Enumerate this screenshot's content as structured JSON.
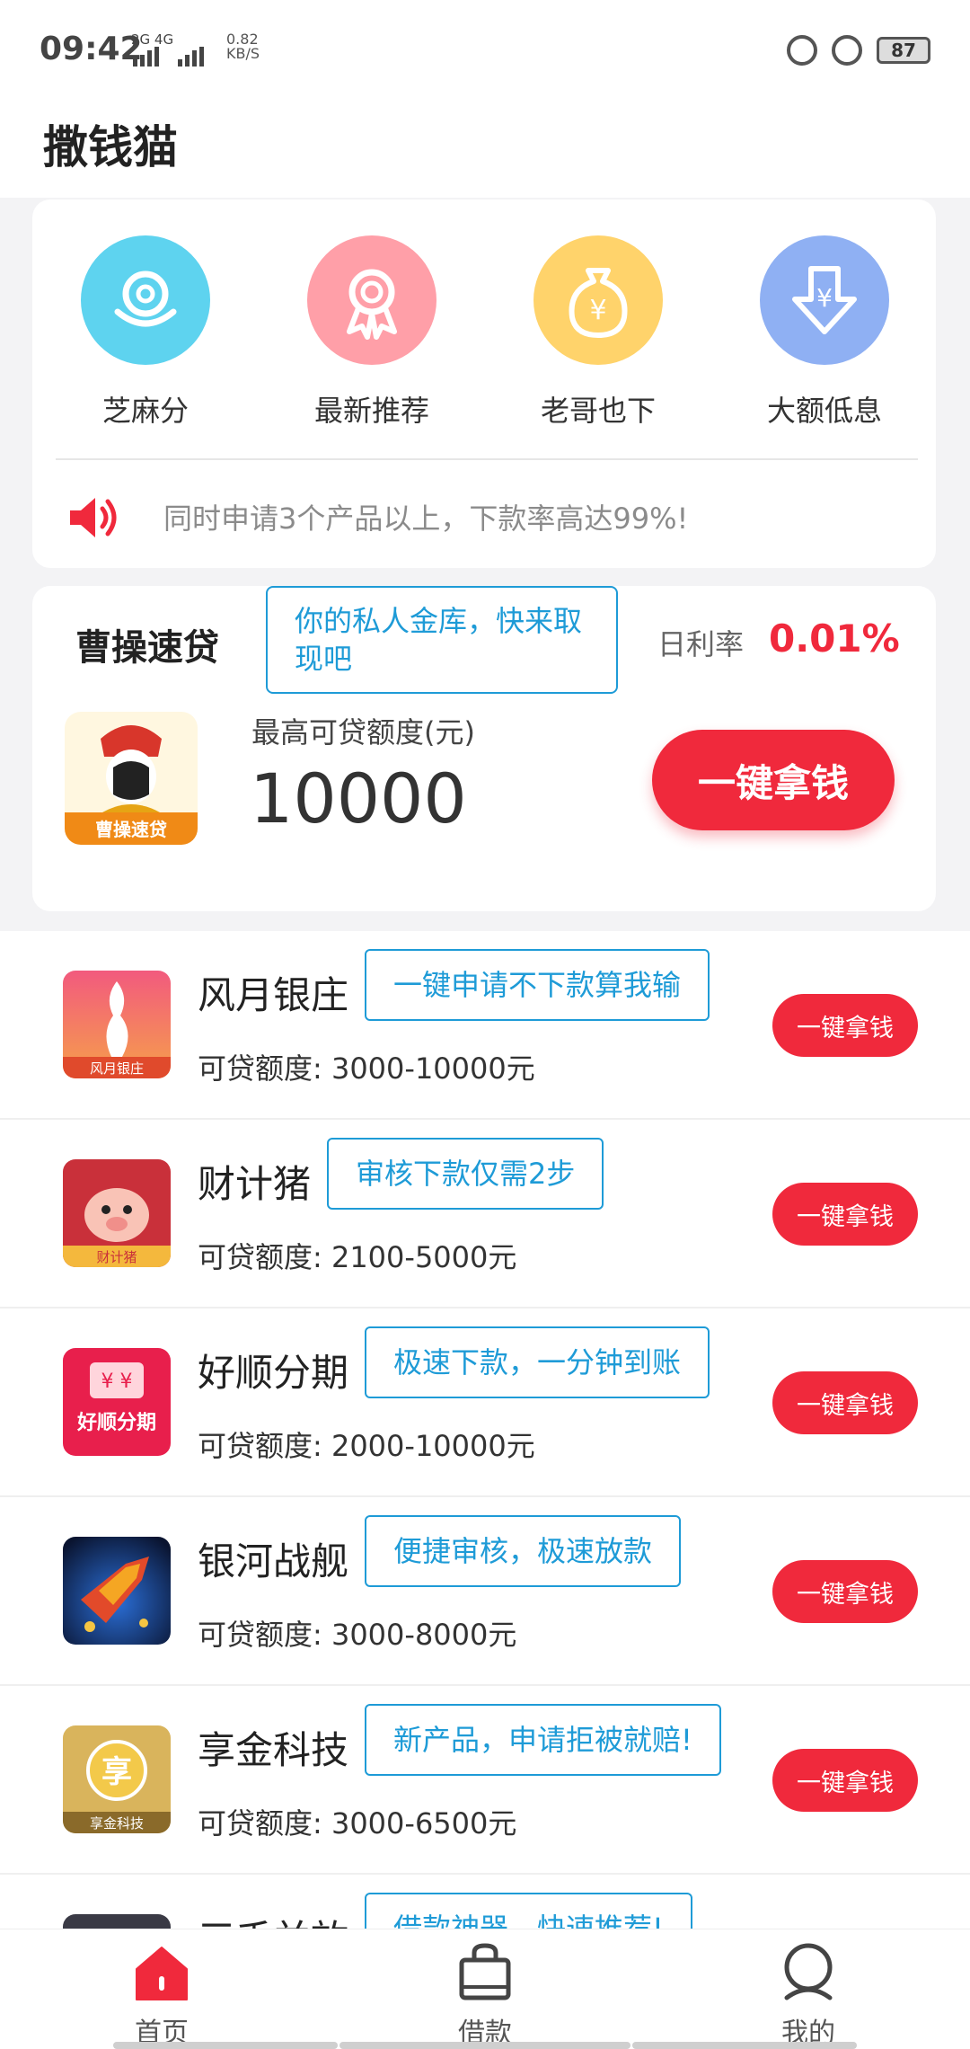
{
  "status_bar": {
    "time": "09:42",
    "signal_text": "2G 4G",
    "speed_value": "0.82",
    "speed_unit": "KB/S",
    "battery": "87"
  },
  "app_title": "撒钱猫",
  "categories": [
    {
      "label": "芝麻分",
      "color": "#5ed3ef",
      "icon": "sesame-credit-icon"
    },
    {
      "label": "最新推荐",
      "color": "#ff9fa8",
      "icon": "award-ribbon-icon"
    },
    {
      "label": "老哥也下",
      "color": "#ffd36b",
      "icon": "money-bag-icon"
    },
    {
      "label": "大额低息",
      "color": "#8fb0f3",
      "icon": "yuan-down-arrow-icon"
    }
  ],
  "notice": {
    "icon": "speaker-icon",
    "text": "同时申请3个产品以上，下款率高达99%!"
  },
  "featured": {
    "name": "曹操速贷",
    "tag": "你的私人金库，快来取现吧",
    "rate_label": "日利率",
    "rate": "0.01%",
    "amount_label": "最高可贷额度(元)",
    "amount": "10000",
    "button": "一键拿钱",
    "logo_text": "曹操速贷",
    "accent": "#f0293c"
  },
  "products": [
    {
      "name": "风月银庄",
      "tag": "一键申请不下款算我输",
      "amount": "可贷额度: 3000-10000元",
      "button": "一键拿钱",
      "logo_text": "风月银庄"
    },
    {
      "name": "财计猪",
      "tag": "审核下款仅需2步",
      "amount": "可贷额度: 2100-5000元",
      "button": "一键拿钱",
      "logo_text": "财计猪"
    },
    {
      "name": "好顺分期",
      "tag": "极速下款，一分钟到账",
      "amount": "可贷额度: 2000-10000元",
      "button": "一键拿钱",
      "logo_text": "好顺分期"
    },
    {
      "name": "银河战舰",
      "tag": "便捷审核，极速放款",
      "amount": "可贷额度: 3000-8000元",
      "button": "一键拿钱",
      "logo_text": ""
    },
    {
      "name": "享金科技",
      "tag": "新产品，申请拒被就赔!",
      "amount": "可贷额度: 3000-6500元",
      "button": "一键拿钱",
      "logo_text": "享金科技"
    },
    {
      "name": "三千并放",
      "tag": "借款神器，快速推荐!",
      "amount": "",
      "button": "",
      "logo_text": ""
    }
  ],
  "tabs": [
    {
      "label": "首页",
      "icon": "home-icon",
      "active": true
    },
    {
      "label": "借款",
      "icon": "shopping-bag-icon",
      "active": false
    },
    {
      "label": "我的",
      "icon": "user-icon",
      "active": false
    }
  ]
}
